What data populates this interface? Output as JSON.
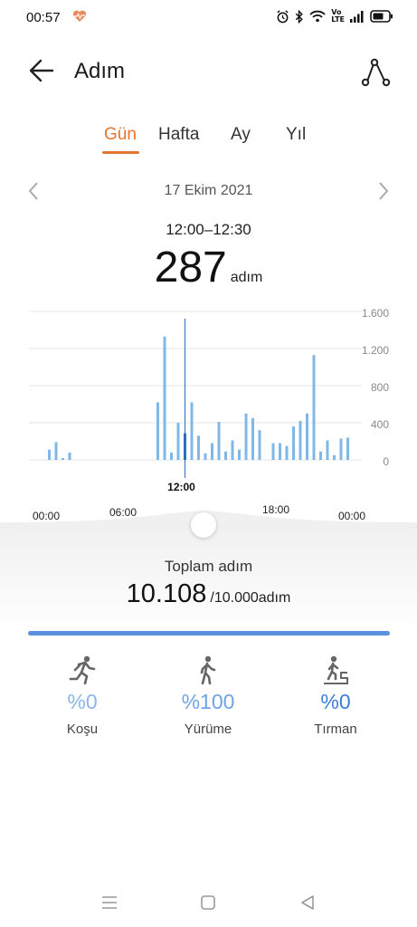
{
  "status": {
    "time": "00:57",
    "volte": "Vo\nLTE",
    "icons": [
      "alarm-icon",
      "bluetooth-icon",
      "wifi-icon",
      "signal-icon",
      "battery-icon"
    ]
  },
  "header": {
    "title": "Adım"
  },
  "tabs": [
    {
      "label": "Gün",
      "active": true
    },
    {
      "label": "Hafta",
      "active": false
    },
    {
      "label": "Ay",
      "active": false
    },
    {
      "label": "Yıl",
      "active": false
    }
  ],
  "date": "17 Ekim 2021",
  "selection": {
    "range": "12:00–12:30",
    "value": "287",
    "unit": "adım"
  },
  "chart_data": {
    "type": "bar",
    "x_tick_labels": [
      "00:00",
      "06:00",
      "12:00",
      "18:00",
      "00:00"
    ],
    "selected_tick": "12:00",
    "y_tick_labels": [
      "0",
      "400",
      "800",
      "1.200",
      "1.600"
    ],
    "ylim": [
      0,
      1600
    ],
    "grid": true,
    "bar_color": "#7fb8e6",
    "selected_color": "#2a6fb8",
    "x": [
      1.5,
      2.0,
      2.5,
      3.0,
      9.5,
      10.0,
      10.5,
      11.0,
      11.5,
      12.0,
      12.5,
      13.0,
      13.5,
      14.0,
      14.5,
      15.0,
      15.5,
      16.0,
      16.5,
      17.0,
      18.0,
      18.5,
      19.0,
      19.5,
      20.0,
      20.5,
      21.0,
      21.5,
      22.0,
      22.5,
      23.0,
      23.5
    ],
    "values": [
      110,
      190,
      20,
      80,
      620,
      1330,
      80,
      400,
      287,
      620,
      260,
      70,
      180,
      410,
      90,
      210,
      110,
      500,
      450,
      320,
      180,
      180,
      150,
      360,
      420,
      500,
      1130,
      90,
      210,
      50,
      230,
      240
    ],
    "selected_index": 8
  },
  "summary": {
    "label": "Toplam adım",
    "value": "10.108",
    "goal": "/10.000adım",
    "progress": 1.0
  },
  "activities": [
    {
      "icon": "running-icon",
      "percent": "%0",
      "label": "Koşu",
      "color": "#8ab8ea"
    },
    {
      "icon": "walking-icon",
      "percent": "%100",
      "label": "Yürüme",
      "color": "#6fa3e6"
    },
    {
      "icon": "climbing-icon",
      "percent": "%0",
      "label": "Tırman",
      "color": "#3b7fd6"
    }
  ],
  "colors": {
    "accent": "#e5742e",
    "progress": "#5b8fe0"
  }
}
